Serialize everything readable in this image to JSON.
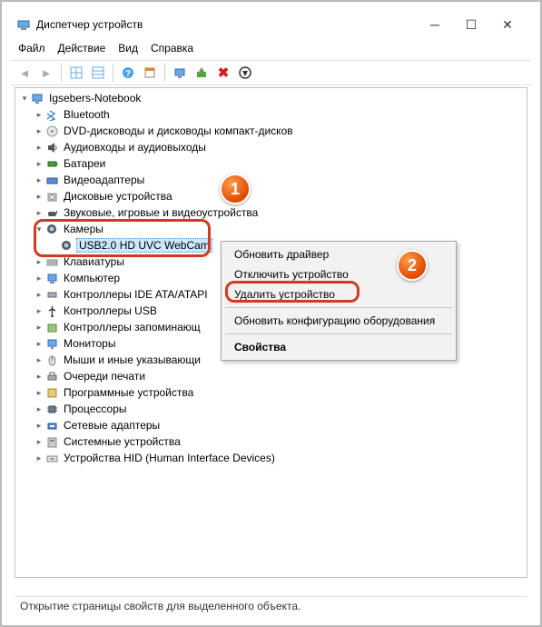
{
  "title": "Диспетчер устройств",
  "menu": {
    "file": "Файл",
    "action": "Действие",
    "view": "Вид",
    "help": "Справка"
  },
  "root": "Igsebers-Notebook",
  "nodes": [
    {
      "icon": "bt",
      "label": "Bluetooth"
    },
    {
      "icon": "disc",
      "label": "DVD-дисководы и дисководы компакт-дисков"
    },
    {
      "icon": "audio",
      "label": "Аудиовходы и аудиовыходы"
    },
    {
      "icon": "batt",
      "label": "Батареи"
    },
    {
      "icon": "video",
      "label": "Видеоадаптеры"
    },
    {
      "icon": "disk",
      "label": "Дисковые устройства"
    },
    {
      "icon": "game",
      "label": "Звуковые, игровые и видеоустройства"
    }
  ],
  "camera_group": "Камеры",
  "camera_device": "USB2.0 HD UVC WebCam",
  "nodes2": [
    {
      "icon": "kbd",
      "label": "Клавиатуры"
    },
    {
      "icon": "pc",
      "label": "Компьютер"
    },
    {
      "icon": "ide",
      "label": "Контроллеры IDE ATA/ATAPI"
    },
    {
      "icon": "usb",
      "label": "Контроллеры USB"
    },
    {
      "icon": "stor",
      "label": "Контроллеры запоминающ"
    },
    {
      "icon": "mon",
      "label": "Мониторы"
    },
    {
      "icon": "mouse",
      "label": "Мыши и иные указывающи"
    },
    {
      "icon": "print",
      "label": "Очереди печати"
    },
    {
      "icon": "sw",
      "label": "Программные устройства"
    },
    {
      "icon": "cpu",
      "label": "Процессоры"
    },
    {
      "icon": "net",
      "label": "Сетевые адаптеры"
    },
    {
      "icon": "sys",
      "label": "Системные устройства"
    },
    {
      "icon": "hid",
      "label": "Устройства HID (Human Interface Devices)"
    }
  ],
  "ctx": {
    "update": "Обновить драйвер",
    "disable": "Отключить устройство",
    "delete": "Удалить устройство",
    "refresh": "Обновить конфигурацию оборудования",
    "props": "Свойства"
  },
  "markers": {
    "one": "1",
    "two": "2"
  },
  "status": "Открытие страницы свойств для выделенного объекта."
}
